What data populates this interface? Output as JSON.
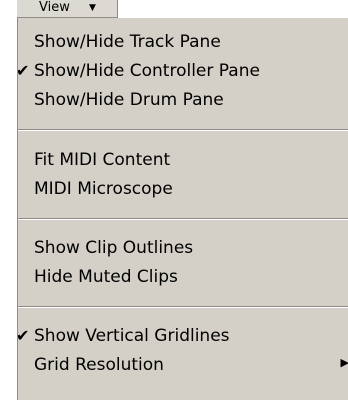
{
  "menubar": {
    "view_label": "View",
    "view_arrow_icon": "chevron-down-icon"
  },
  "menu": {
    "items": [
      {
        "label": "Show/Hide Track Pane",
        "checked": false
      },
      {
        "label": "Show/Hide Controller Pane",
        "checked": true
      },
      {
        "label": "Show/Hide Drum Pane",
        "checked": false
      },
      {
        "label": "Fit MIDI Content",
        "checked": false
      },
      {
        "label": "MIDI Microscope",
        "checked": false
      },
      {
        "label": "Show Clip Outlines",
        "checked": false
      },
      {
        "label": "Hide Muted Clips",
        "checked": false
      },
      {
        "label": "Show Vertical Gridlines",
        "checked": true
      },
      {
        "label": "Grid Resolution",
        "checked": false,
        "has_submenu": true
      }
    ],
    "check_glyph": "✔",
    "submenu_glyph": "▶"
  },
  "colors": {
    "menu_background": "#d4d0c8",
    "text": "#000000"
  }
}
